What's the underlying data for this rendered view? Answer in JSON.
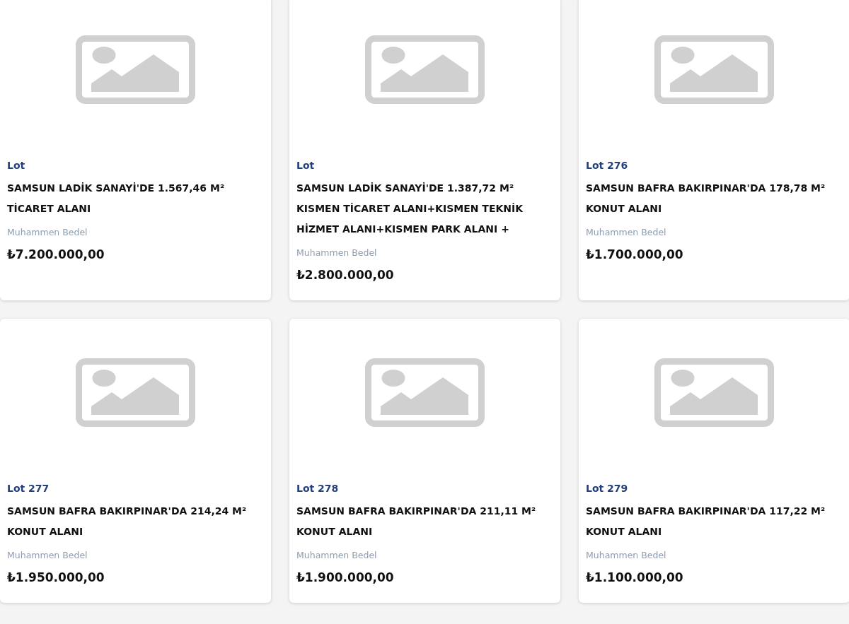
{
  "lots": [
    {
      "lot": "Lot",
      "title": "SAMSUN LADİK SANAYİ'DE 1.567,46 M² TİCARET ALANI",
      "price_label": "Muhammen Bedel",
      "price": "₺7.200.000,00"
    },
    {
      "lot": "Lot",
      "title": "SAMSUN LADİK SANAYİ'DE 1.387,72 M² KISMEN TİCARET ALANI+KISMEN TEKNİK HİZMET ALANI+KISMEN PARK ALANI +",
      "price_label": "Muhammen Bedel",
      "price": "₺2.800.000,00"
    },
    {
      "lot": "Lot 276",
      "title": "SAMSUN BAFRA BAKIRPINAR'DA 178,78 M² KONUT ALANI",
      "price_label": "Muhammen Bedel",
      "price": "₺1.700.000,00"
    },
    {
      "lot": "Lot 277",
      "title": "SAMSUN BAFRA BAKIRPINAR'DA 214,24 M² KONUT ALANI",
      "price_label": "Muhammen Bedel",
      "price": "₺1.950.000,00"
    },
    {
      "lot": "Lot 278",
      "title": "SAMSUN BAFRA BAKIRPINAR'DA 211,11 M² KONUT ALANI",
      "price_label": "Muhammen Bedel",
      "price": "₺1.900.000,00"
    },
    {
      "lot": "Lot 279",
      "title": "SAMSUN BAFRA BAKIRPINAR'DA 117,22 M² KONUT ALANI",
      "price_label": "Muhammen Bedel",
      "price": "₺1.100.000,00"
    }
  ]
}
